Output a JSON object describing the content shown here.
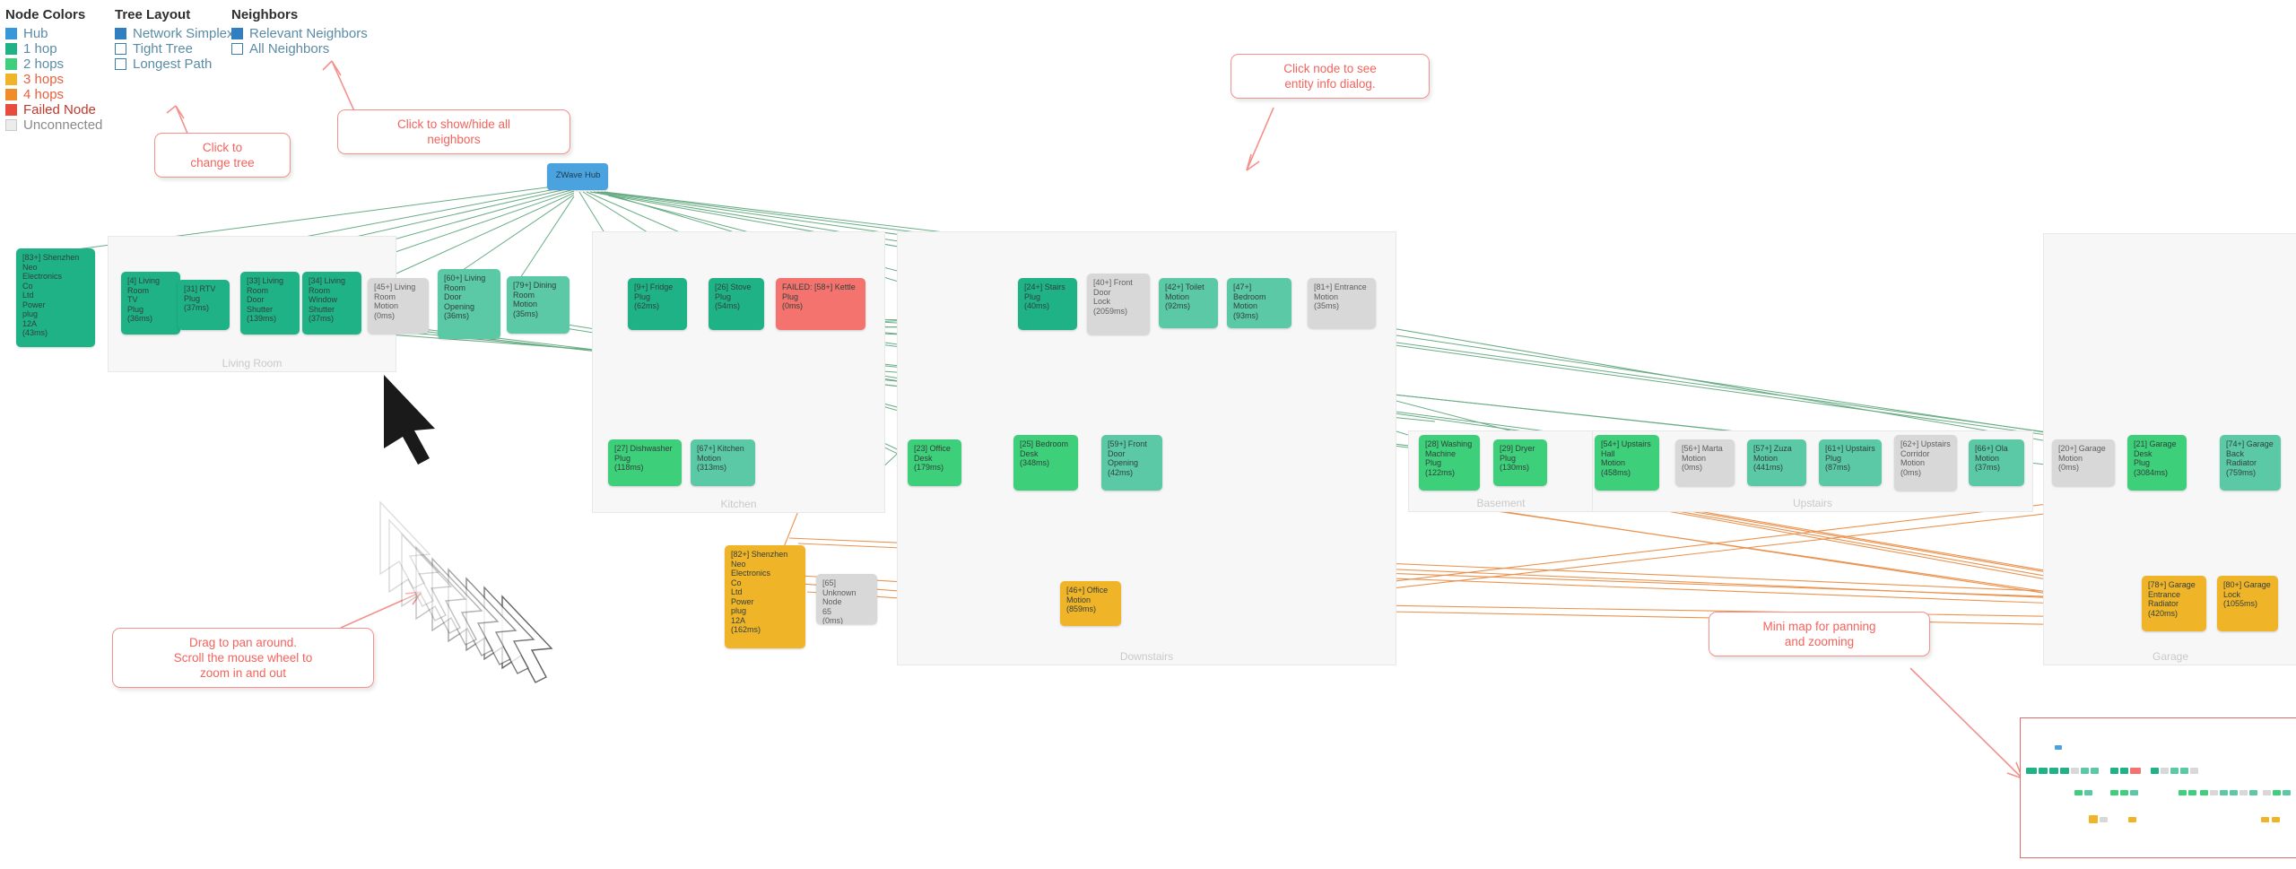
{
  "legend": {
    "node_colors": {
      "title": "Node Colors",
      "items": [
        {
          "label": "Hub",
          "color": "#3498db"
        },
        {
          "label": "1 hop",
          "color": "#1fb287"
        },
        {
          "label": "2 hops",
          "color": "#3ecf7a"
        },
        {
          "label": "3 hops",
          "color": "#f0b429"
        },
        {
          "label": "4 hops",
          "color": "#f08c29"
        },
        {
          "label": "Failed Node",
          "color": "#e74c3c"
        },
        {
          "label": "Unconnected",
          "color": "#d8d8d8"
        }
      ]
    },
    "tree_layout": {
      "title": "Tree Layout",
      "items": [
        {
          "label": "Network Simplex",
          "checked": true
        },
        {
          "label": "Tight Tree",
          "checked": false
        },
        {
          "label": "Longest Path",
          "checked": false
        }
      ]
    },
    "neighbors": {
      "title": "Neighbors",
      "items": [
        {
          "label": "Relevant Neighbors",
          "checked": true
        },
        {
          "label": "All Neighbors",
          "checked": false
        }
      ]
    }
  },
  "callouts": [
    {
      "id": "change-tree",
      "text": "Click to\nchange tree"
    },
    {
      "id": "show-hide-neighbors",
      "text": "Click to show/hide all\nneighbors"
    },
    {
      "id": "entity-info",
      "text": "Click node to see\nentity info dialog."
    },
    {
      "id": "pan-zoom",
      "text": "Drag to pan around.\nScroll the mouse wheel to\nzoom in and out"
    },
    {
      "id": "mini-map",
      "text": "Mini map for panning\nand zooming"
    }
  ],
  "groups": [
    {
      "label": "Living Room"
    },
    {
      "label": "Kitchen"
    },
    {
      "label": "Downstairs"
    },
    {
      "label": "Basement"
    },
    {
      "label": "Upstairs"
    },
    {
      "label": "Garage"
    }
  ],
  "hub": {
    "label": "ZWave Hub"
  },
  "nodes": [
    {
      "id": "83",
      "text": "[83+] Shenzhen\nNeo\nElectronics\nCo\nLtd\nPower\nplug\n12A\n(43ms)",
      "kind": "h1"
    },
    {
      "id": "4",
      "text": "[4] Living\nRoom\nTV\nPlug\n(36ms)",
      "kind": "h1"
    },
    {
      "id": "31",
      "text": "[31] RTV\nPlug\n(37ms)",
      "kind": "h1"
    },
    {
      "id": "33",
      "text": "[33] Living\nRoom\nDoor\nShutter\n(139ms)",
      "kind": "h1"
    },
    {
      "id": "34",
      "text": "[34] Living\nRoom\nWindow\nShutter\n(37ms)",
      "kind": "h1"
    },
    {
      "id": "45",
      "text": "[45+] Living\nRoom\nMotion\n(0ms)",
      "kind": "off"
    },
    {
      "id": "60",
      "text": "[60+] Living\nRoom\nDoor\nOpening\n(36ms)",
      "kind": "tile"
    },
    {
      "id": "79",
      "text": "[79+] Dining\nRoom\nMotion\n(35ms)",
      "kind": "tile"
    },
    {
      "id": "9",
      "text": "[9+] Fridge\nPlug\n(62ms)",
      "kind": "h1"
    },
    {
      "id": "26",
      "text": "[26] Stove\nPlug\n(54ms)",
      "kind": "h1"
    },
    {
      "id": "58",
      "text": "FAILED: [58+] Kettle\nPlug\n(0ms)",
      "kind": "failed"
    },
    {
      "id": "24",
      "text": "[24+] Stairs\nPlug\n(40ms)",
      "kind": "h1"
    },
    {
      "id": "40",
      "text": "[40+] Front\nDoor\nLock\n(2059ms)",
      "kind": "off"
    },
    {
      "id": "42",
      "text": "[42+] Toilet\nMotion\n(92ms)",
      "kind": "tile"
    },
    {
      "id": "47",
      "text": "[47+] Bedroom\nMotion\n(93ms)",
      "kind": "tile"
    },
    {
      "id": "81",
      "text": "[81+] Entrance\nMotion\n(35ms)",
      "kind": "off"
    },
    {
      "id": "27",
      "text": "[27] Dishwasher\nPlug\n(118ms)",
      "kind": "h2"
    },
    {
      "id": "67",
      "text": "[67+] Kitchen\nMotion\n(313ms)",
      "kind": "tile"
    },
    {
      "id": "23",
      "text": "[23] Office\nDesk\n(179ms)",
      "kind": "h2"
    },
    {
      "id": "25",
      "text": "[25] Bedroom\nDesk\n(348ms)",
      "kind": "h2"
    },
    {
      "id": "59",
      "text": "[59+] Front\nDoor\nOpening\n(42ms)",
      "kind": "tile"
    },
    {
      "id": "28",
      "text": "[28] Washing\nMachine\nPlug\n(122ms)",
      "kind": "h2"
    },
    {
      "id": "29",
      "text": "[29] Dryer\nPlug\n(130ms)",
      "kind": "h2"
    },
    {
      "id": "54",
      "text": "[54+] Upstairs\nHall\nMotion\n(458ms)",
      "kind": "h2"
    },
    {
      "id": "56",
      "text": "[56+] Marta\nMotion\n(0ms)",
      "kind": "off"
    },
    {
      "id": "57",
      "text": "[57+] Zuza\nMotion\n(441ms)",
      "kind": "tile"
    },
    {
      "id": "61",
      "text": "[61+] Upstairs\nPlug\n(87ms)",
      "kind": "tile"
    },
    {
      "id": "62",
      "text": "[62+] Upstairs\nCorridor\nMotion\n(0ms)",
      "kind": "off"
    },
    {
      "id": "66",
      "text": "[66+] Ola\nMotion\n(37ms)",
      "kind": "tile"
    },
    {
      "id": "20",
      "text": "[20+] Garage\nMotion\n(0ms)",
      "kind": "off"
    },
    {
      "id": "21",
      "text": "[21] Garage\nDesk\nPlug\n(3084ms)",
      "kind": "h2"
    },
    {
      "id": "74",
      "text": "[74+] Garage\nBack\nRadiator\n(759ms)",
      "kind": "tile"
    },
    {
      "id": "82",
      "text": "[82+] Shenzhen\nNeo\nElectronics\nCo\nLtd\nPower\nplug\n12A\n(162ms)",
      "kind": "h3"
    },
    {
      "id": "65",
      "text": "[65] Unknown\nNode\n65\n(0ms)",
      "kind": "off"
    },
    {
      "id": "46",
      "text": "[46+] Office\nMotion\n(859ms)",
      "kind": "h3"
    },
    {
      "id": "78",
      "text": "[78+] Garage\nEntrance\nRadiator\n(420ms)",
      "kind": "h3"
    },
    {
      "id": "80",
      "text": "[80+] Garage\nLock\n(1055ms)",
      "kind": "h3"
    }
  ]
}
